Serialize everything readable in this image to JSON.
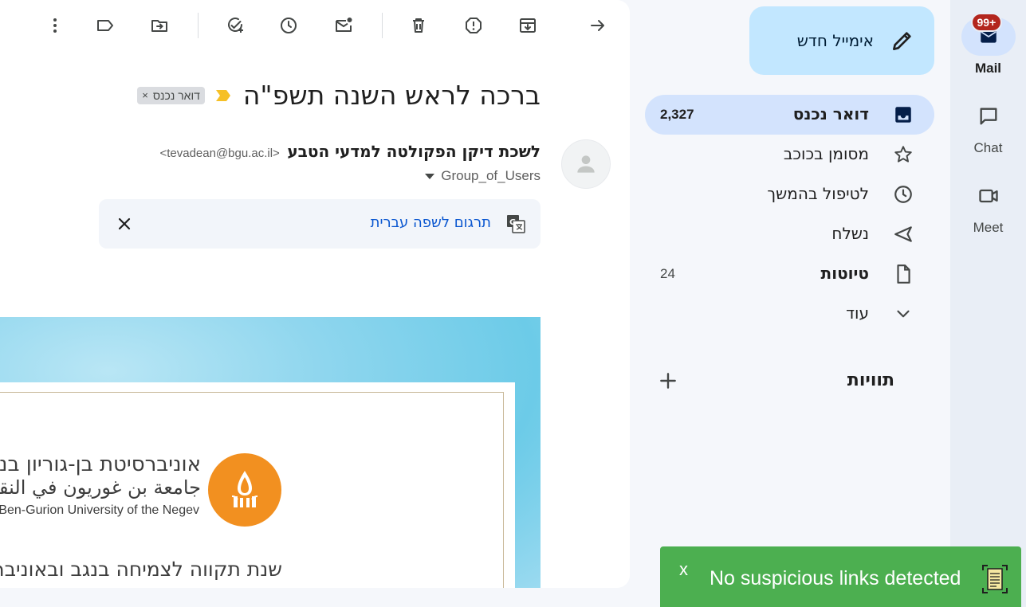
{
  "toolbar": {
    "more_icon": "more-vert-icon",
    "label_icon": "label-icon",
    "move_icon": "move-to-icon",
    "add_task_icon": "add-task-icon",
    "snooze_icon": "snooze-icon",
    "mark_unread_icon": "mark-unread-icon",
    "delete_icon": "delete-icon",
    "spam_icon": "report-spam-icon",
    "archive_icon": "archive-icon",
    "back_icon": "back-arrow-icon"
  },
  "message": {
    "subject": "ברכה לראש השנה תשפ\"ה",
    "label_chip": "דואר נכנס",
    "label_chip_close": "×",
    "sender_name": "לשכת דיקן הפקולטה למדעי הטבע",
    "sender_email": "<tevadean@bgu.ac.il>",
    "recipient": "Group_of_Users",
    "translate_link": "תרגום לשפה עברית",
    "translate_close": "✕"
  },
  "email_body": {
    "university_he": "אוניברסיטת בן-גוריון בנגב",
    "university_ar": "جامعة بن غوريون في النقب",
    "university_en": "Ben-Gurion University of the Negev",
    "slogan": "שנת תקווה לצמיחה בנגב ובאוניברסיטה"
  },
  "compose": {
    "label": "אימייל חדש"
  },
  "nav": {
    "items": [
      {
        "label": "דואר נכנס",
        "count": "2,327",
        "icon": "inbox-icon",
        "bold": true,
        "active": true
      },
      {
        "label": "מסומן בכוכב",
        "count": "",
        "icon": "star-icon",
        "bold": false,
        "active": false
      },
      {
        "label": "לטיפול בהמשך",
        "count": "",
        "icon": "clock-icon",
        "bold": false,
        "active": false
      },
      {
        "label": "נשלח",
        "count": "",
        "icon": "send-icon",
        "bold": false,
        "active": false
      },
      {
        "label": "טיוטות",
        "count": "24",
        "icon": "draft-icon",
        "bold": true,
        "active": false
      },
      {
        "label": "עוד",
        "count": "",
        "icon": "expand-more-icon",
        "bold": false,
        "active": false
      }
    ],
    "labels_title": "תוויות",
    "labels_add": "+"
  },
  "rail": {
    "mail": {
      "label": "Mail",
      "badge": "99+"
    },
    "chat": {
      "label": "Chat"
    },
    "meet": {
      "label": "Meet"
    }
  },
  "toast": {
    "close": "x",
    "text": "No suspicious links detected"
  },
  "colors": {
    "compose_bg": "#c2e7ff",
    "active_nav": "#d3e3fd",
    "toast_bg": "#4caf50",
    "badge_bg": "#b3261e",
    "logo_orange": "#f29020",
    "important_marker": "#f6c026"
  }
}
